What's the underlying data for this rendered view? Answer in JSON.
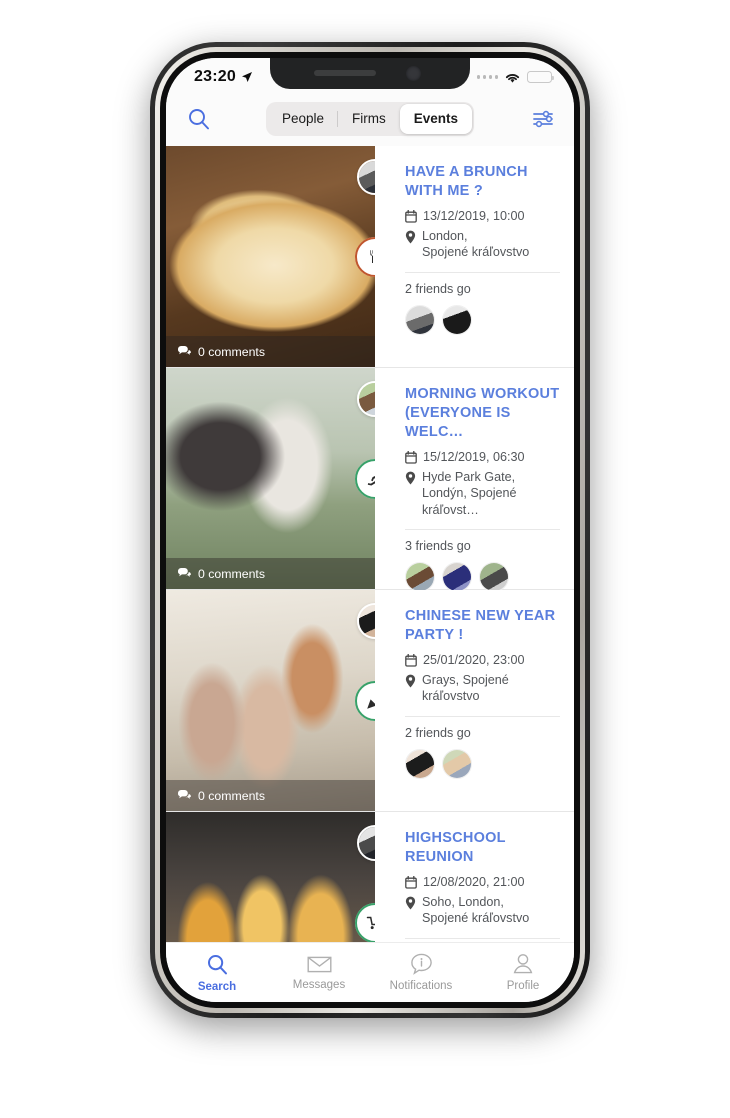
{
  "status_bar": {
    "time": "23:20",
    "location_icon": "location-arrow-icon",
    "wifi_icon": "wifi-icon",
    "battery_icon": "battery-icon"
  },
  "top_bar": {
    "search_icon": "search-icon",
    "filter_icon": "filter-sliders-icon",
    "segments": [
      {
        "label": "People",
        "active": false
      },
      {
        "label": "Firms",
        "active": false
      },
      {
        "label": "Events",
        "active": true
      }
    ]
  },
  "feed": {
    "events": [
      {
        "title": "HAVE A BRUNCH WITH ME ?",
        "date": "13/12/2019, 10:00",
        "location_line1": "London,",
        "location_line2": "Spojené kráľovstvo",
        "friends_label": "2 friends go",
        "comments": "0 comments",
        "category_icon": "cutlery-icon",
        "category_ring_color": "#c0562e",
        "photo": "pizza",
        "author_avatar": "au-1",
        "friend_avatars": [
          "fa-m1",
          "fa-m2"
        ]
      },
      {
        "title": "MORNING WORKOUT (EVERYONE IS WELC…",
        "date": "15/12/2019, 06:30",
        "location_line1": "Hyde Park Gate,",
        "location_line2": "Londýn, Spojené kráľovst…",
        "friends_label": "3 friends go",
        "comments": "0 comments",
        "category_icon": "running-icon",
        "category_ring_color": "#38a169",
        "photo": "park",
        "author_avatar": "au-2",
        "friend_avatars": [
          "fa-m3",
          "fa-m4",
          "fa-m5"
        ]
      },
      {
        "title": "CHINESE NEW YEAR PARTY !",
        "date": "25/01/2020, 23:00",
        "location_line1": "Grays, Spojené",
        "location_line2": "kráľovstvo",
        "friends_label": "2 friends go",
        "comments": "0 comments",
        "category_icon": "party-popper-icon",
        "category_ring_color": "#38a169",
        "photo": "friends",
        "author_avatar": "au-3",
        "friend_avatars": [
          "fa-f1",
          "fa-f2"
        ]
      },
      {
        "title": "HIGHSCHOOL REUNION",
        "date": "12/08/2020, 21:00",
        "location_line1": "Soho, London,",
        "location_line2": "Spojené kráľovstvo",
        "friends_label": "",
        "comments": "",
        "category_icon": "cart-icon",
        "category_ring_color": "#38a169",
        "photo": "drinks",
        "author_avatar": "au-4",
        "friend_avatars": []
      }
    ],
    "icons": {
      "date_icon": "calendar-icon",
      "location_icon": "map-pin-icon",
      "comment_icon": "comment-bubbles-icon"
    }
  },
  "bottom_nav": {
    "items": [
      {
        "label": "Search",
        "icon": "search-icon",
        "active": true
      },
      {
        "label": "Messages",
        "icon": "envelope-icon",
        "active": false
      },
      {
        "label": "Notifications",
        "icon": "info-bubble-icon",
        "active": false
      },
      {
        "label": "Profile",
        "icon": "person-icon",
        "active": false
      }
    ]
  },
  "colors": {
    "accent_blue": "#4a6ee0",
    "title_blue": "#5b7fdd",
    "food_ring": "#c0562e",
    "sport_ring": "#38a169",
    "battery_yellow": "#f2c12b"
  }
}
